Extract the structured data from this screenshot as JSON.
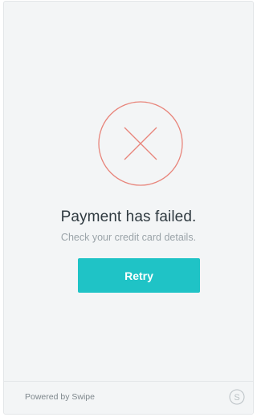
{
  "status": {
    "title": "Payment has failed.",
    "message": "Check your credit card details.",
    "icon": "error-x-circle-icon",
    "icon_color": "#e8857b"
  },
  "actions": {
    "retry_label": "Retry",
    "retry_color": "#1fc3c6"
  },
  "footer": {
    "powered_by": "Powered by Swipe",
    "logo_icon": "swipe-logo-icon",
    "logo_letter": "S"
  }
}
